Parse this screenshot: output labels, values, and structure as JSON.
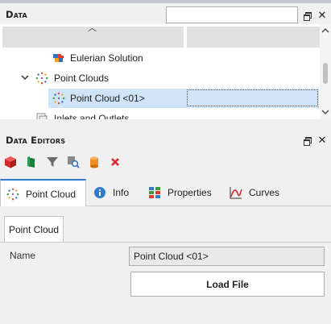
{
  "data_panel": {
    "title": "Data",
    "search_value": "",
    "tree": [
      {
        "label": "Eulerian Solution",
        "icon": "eulerian-solution-icon",
        "depth": 2
      },
      {
        "label": "Point Clouds",
        "icon": "point-cloud-icon",
        "depth": 1,
        "expanded": true
      },
      {
        "label": "Point Cloud <01>",
        "icon": "point-cloud-icon",
        "depth": 2,
        "selected": true
      },
      {
        "label": "Inlets and Outlets",
        "icon": "inlets-outlets-icon",
        "depth": 1
      }
    ]
  },
  "editors_panel": {
    "title": "Data Editors",
    "toolbar": [
      "red-cube-icon",
      "green-flag-icon",
      "filter-icon",
      "search-data-icon",
      "cylinder-icon",
      "delete-icon"
    ],
    "tabs": [
      {
        "label": "Point Cloud",
        "icon": "point-cloud-icon",
        "active": true
      },
      {
        "label": "Info",
        "icon": "info-icon",
        "active": false
      },
      {
        "label": "Properties",
        "icon": "properties-icon",
        "active": false
      },
      {
        "label": "Curves",
        "icon": "curves-icon",
        "active": false
      }
    ],
    "subtab": "Point Cloud",
    "name_label": "Name",
    "name_value": "Point Cloud <01>",
    "load_button": "Load File"
  },
  "colors": {
    "accent": "#2e7bcf",
    "selection": "#cfe4f7",
    "delete": "#e0262b"
  }
}
